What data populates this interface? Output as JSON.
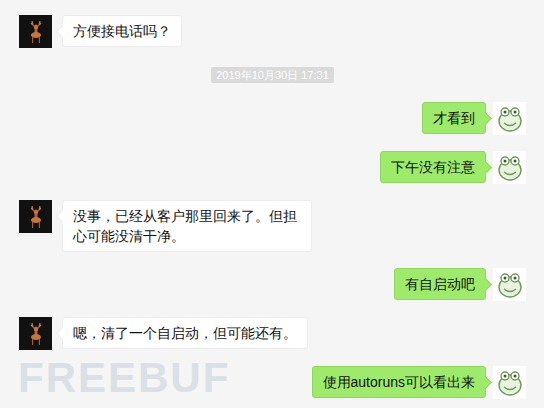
{
  "messages": [
    {
      "kind": "message",
      "side": "left",
      "text": "方便接电话吗？"
    },
    {
      "kind": "time",
      "text": "2019年10月30日 17:31"
    },
    {
      "kind": "message",
      "side": "right",
      "text": "才看到"
    },
    {
      "kind": "message",
      "side": "right",
      "text": "下午没有注意"
    },
    {
      "kind": "message",
      "side": "left",
      "text": "没事，已经从客户那里回来了。但担心可能没清干净。"
    },
    {
      "kind": "message",
      "side": "right",
      "text": "有自启动吧"
    },
    {
      "kind": "message",
      "side": "left",
      "text": "嗯，清了一个自启动，但可能还有。"
    },
    {
      "kind": "message",
      "side": "right",
      "text": "使用autoruns可以看出来"
    }
  ],
  "watermark": "FREEBUF"
}
